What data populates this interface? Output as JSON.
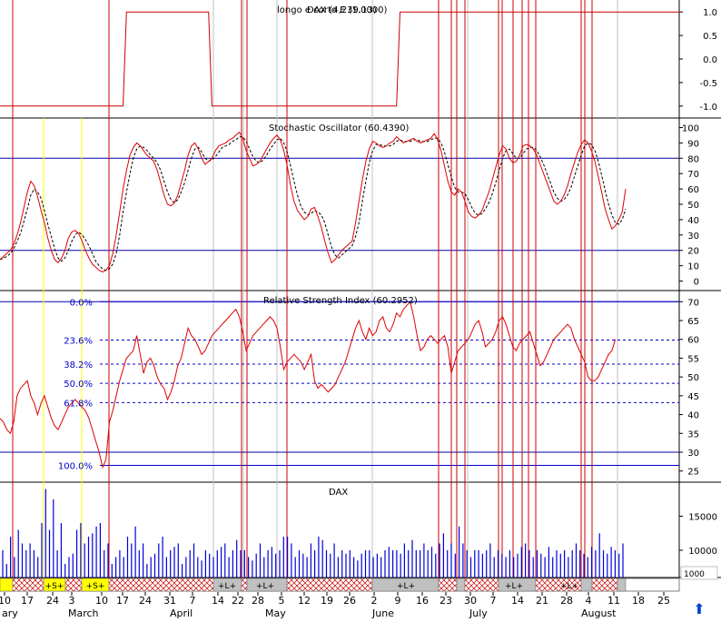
{
  "chart_data": [
    {
      "type": "line",
      "title": "longo e corto E (1.0000)",
      "title_overlay": "DAX (4,239.13)",
      "y_ticks": [
        "1.0",
        "0.5",
        "0.0",
        "-0.5",
        "-1.0"
      ],
      "ylim": [
        -1.1,
        1.1
      ],
      "series": [
        {
          "values": [
            -1,
            -1,
            -1,
            -1,
            -1,
            -1,
            -1,
            -1,
            -1,
            -1,
            -1,
            -1,
            -1,
            -1,
            -1,
            -1,
            -1,
            -1,
            -1,
            -1,
            -1,
            -1,
            -1,
            -1,
            -1,
            -1,
            -1,
            -1,
            -1,
            -1,
            -1,
            -1,
            -1,
            -1,
            -1,
            -1,
            -1,
            1,
            1,
            1,
            1,
            1,
            1,
            1,
            1,
            1,
            1,
            1,
            1,
            1,
            1,
            1,
            1,
            1,
            1,
            1,
            1,
            1,
            1,
            1,
            1,
            1,
            -1,
            -1,
            -1,
            -1,
            -1,
            -1,
            -1,
            -1,
            -1,
            -1,
            -1,
            -1,
            -1,
            -1,
            -1,
            -1,
            -1,
            -1,
            -1,
            -1,
            -1,
            -1,
            -1,
            -1,
            -1,
            -1,
            -1,
            -1,
            -1,
            -1,
            -1,
            -1,
            -1,
            -1,
            -1,
            -1,
            -1,
            -1,
            -1,
            -1,
            -1,
            -1,
            -1,
            -1,
            -1,
            -1,
            -1,
            -1,
            -1,
            -1,
            -1,
            -1,
            -1,
            -1,
            -1,
            1,
            1,
            1,
            1,
            1,
            1,
            1,
            1,
            1,
            1,
            1,
            1,
            1,
            1,
            1,
            1,
            1,
            1,
            1,
            1,
            1,
            1,
            1,
            1,
            1,
            1,
            1,
            1,
            1,
            1,
            1,
            1,
            1,
            1,
            1,
            1,
            1,
            1,
            1,
            1,
            1,
            1,
            1,
            1,
            1,
            1,
            1,
            1,
            1,
            1,
            1,
            1,
            1,
            1,
            1,
            1,
            1,
            1,
            1,
            1,
            1,
            1,
            1,
            1,
            1,
            1,
            1,
            1,
            1,
            1,
            1,
            1,
            1,
            1,
            1,
            1,
            1,
            1,
            1,
            1,
            1,
            1,
            1
          ]
        }
      ]
    },
    {
      "type": "line",
      "title": "Stochastic Oscillator (60.4390)",
      "y_ticks": [
        "100",
        "90",
        "80",
        "70",
        "60",
        "50",
        "40",
        "30",
        "20",
        "10",
        "0"
      ],
      "ylim": [
        -5,
        105
      ],
      "reference_lines": [
        80,
        20
      ],
      "series": [
        {
          "values": [
            14,
            16,
            18,
            20,
            24,
            30,
            38,
            48,
            58,
            65,
            62,
            55,
            46,
            38,
            28,
            20,
            14,
            12,
            15,
            20,
            28,
            32,
            33,
            31,
            26,
            20,
            15,
            11,
            9,
            7,
            6,
            7,
            10,
            18,
            30,
            45,
            60,
            72,
            82,
            87,
            90,
            88,
            85,
            82,
            80,
            78,
            72,
            64,
            56,
            50,
            49,
            51,
            56,
            64,
            72,
            82,
            88,
            90,
            86,
            80,
            76,
            78,
            80,
            85,
            88,
            89,
            90,
            92,
            93,
            95,
            97,
            93,
            85,
            80,
            75,
            76,
            78,
            82,
            86,
            90,
            93,
            95,
            92,
            85,
            75,
            62,
            52,
            46,
            43,
            40,
            42,
            47,
            48,
            42,
            35,
            26,
            18,
            12,
            14,
            17,
            20,
            22,
            24,
            26,
            38,
            52,
            66,
            78,
            86,
            91,
            90,
            88,
            87,
            88,
            90,
            91,
            94,
            92,
            90,
            91,
            92,
            93,
            91,
            90,
            91,
            92,
            93,
            96,
            92,
            85,
            75,
            65,
            58,
            56,
            60,
            58,
            52,
            45,
            42,
            41,
            43,
            46,
            52,
            58,
            66,
            74,
            82,
            88,
            86,
            80,
            77,
            78,
            82,
            88,
            89,
            88,
            86,
            82,
            76,
            70,
            64,
            58,
            52,
            50,
            52,
            56,
            62,
            70,
            77,
            84,
            89,
            92,
            90,
            85,
            78,
            68,
            58,
            47,
            40,
            34,
            36,
            40,
            45,
            60
          ]
        },
        {
          "values": [
            14,
            15,
            16,
            18,
            21,
            26,
            31,
            39,
            47,
            56,
            60,
            58,
            54,
            46,
            37,
            29,
            21,
            15,
            13,
            15,
            20,
            26,
            30,
            32,
            30,
            27,
            23,
            18,
            13,
            10,
            8,
            7,
            8,
            11,
            18,
            30,
            45,
            58,
            70,
            80,
            86,
            88,
            87,
            85,
            82,
            80,
            77,
            72,
            65,
            58,
            53,
            51,
            53,
            58,
            64,
            72,
            80,
            86,
            87,
            84,
            80,
            78,
            79,
            81,
            84,
            87,
            88,
            89,
            91,
            92,
            94,
            94,
            91,
            86,
            81,
            78,
            77,
            79,
            82,
            86,
            89,
            92,
            93,
            90,
            84,
            75,
            65,
            56,
            49,
            45,
            43,
            44,
            46,
            45,
            43,
            38,
            30,
            22,
            17,
            15,
            17,
            19,
            21,
            23,
            29,
            38,
            52,
            65,
            77,
            85,
            89,
            89,
            88,
            88,
            88,
            89,
            91,
            92,
            91,
            91,
            91,
            92,
            92,
            91,
            91,
            91,
            92,
            93,
            93,
            90,
            84,
            76,
            68,
            61,
            58,
            58,
            57,
            53,
            48,
            44,
            43,
            44,
            47,
            51,
            57,
            64,
            72,
            80,
            85,
            86,
            83,
            80,
            80,
            83,
            86,
            87,
            87,
            85,
            81,
            76,
            70,
            64,
            58,
            54,
            52,
            53,
            56,
            61,
            68,
            75,
            82,
            88,
            90,
            89,
            85,
            78,
            69,
            59,
            50,
            43,
            38,
            37,
            40,
            47
          ]
        }
      ]
    },
    {
      "type": "line",
      "title": "Relative Strength Index (60.2952)",
      "y_ticks": [
        "70",
        "65",
        "60",
        "55",
        "50",
        "45",
        "40",
        "35",
        "30",
        "25"
      ],
      "ylim": [
        23,
        72
      ],
      "fib_levels": [
        {
          "label": "0.0%",
          "value": 70
        },
        {
          "label": "23.6%",
          "value": 59.8
        },
        {
          "label": "38.2%",
          "value": 53.4
        },
        {
          "label": "50.0%",
          "value": 48.3
        },
        {
          "label": "61.8%",
          "value": 43.2
        },
        {
          "label": "100.0%",
          "value": 26.5
        }
      ],
      "reference_lines": [
        70,
        30
      ],
      "series": [
        {
          "values": [
            39,
            38,
            36,
            35,
            38,
            45,
            47,
            48,
            49,
            45,
            43,
            40,
            43,
            45,
            42,
            39,
            37,
            36,
            38,
            40,
            42,
            43,
            44,
            43,
            42,
            41,
            39,
            36,
            33,
            30,
            26,
            28,
            38,
            41,
            45,
            49,
            52,
            55,
            56,
            57,
            61,
            56,
            51,
            54,
            55,
            53,
            50,
            48,
            47,
            44,
            46,
            49,
            53,
            55,
            59,
            63,
            61,
            60,
            58,
            56,
            57,
            59,
            61,
            62,
            63,
            64,
            65,
            66,
            67,
            68,
            66,
            62,
            57,
            59,
            61,
            62,
            63,
            64,
            65,
            66,
            65,
            63,
            58,
            52,
            54,
            55,
            56,
            55,
            54,
            52,
            54,
            56,
            49,
            47,
            48,
            47,
            46,
            47,
            48,
            50,
            52,
            54,
            57,
            60,
            63,
            65,
            62,
            60,
            63,
            61,
            62,
            65,
            66,
            63,
            62,
            64,
            67,
            66,
            68,
            69,
            70,
            66,
            61,
            57,
            58,
            60,
            61,
            60,
            59,
            60,
            61,
            58,
            51,
            54,
            57,
            58,
            59,
            60,
            62,
            64,
            65,
            62,
            58,
            59,
            60,
            62,
            65,
            66,
            64,
            61,
            58,
            57,
            59,
            60,
            61,
            62,
            59,
            56,
            53,
            54,
            56,
            58,
            60,
            61,
            62,
            63,
            64,
            63,
            60,
            58,
            56,
            54,
            50,
            49,
            49,
            50,
            52,
            54,
            56,
            57,
            60
          ]
        }
      ]
    },
    {
      "type": "bar",
      "title": "DAX",
      "y_ticks": [
        "15000",
        "10000"
      ],
      "ylim": [
        6000,
        20000
      ],
      "series": [
        {
          "values": [
            10000,
            8000,
            12000,
            9000,
            13000,
            11000,
            10000,
            11000,
            10000,
            9000,
            14000,
            19000,
            13000,
            17500,
            10000,
            14000,
            8000,
            9000,
            9500,
            13000,
            14000,
            11000,
            12000,
            12500,
            13500,
            14000,
            10000,
            11000,
            8000,
            9000,
            10000,
            9000,
            12000,
            11000,
            13500,
            10000,
            11000,
            8000,
            9000,
            9500,
            11000,
            12000,
            9000,
            10000,
            10500,
            11000,
            8000,
            9000,
            10000,
            11000,
            9000,
            8500,
            10000,
            9500,
            9000,
            10000,
            10500,
            11000,
            9000,
            10000,
            11500,
            10000,
            10000,
            9000,
            8500,
            9500,
            11000,
            9000,
            10000,
            10500,
            9500,
            10000,
            12000,
            12000,
            11000,
            9000,
            10000,
            9500,
            9000,
            11000,
            10000,
            12000,
            11500,
            10000,
            9500,
            11000,
            9000,
            10000,
            9500,
            10000,
            9000,
            8500,
            9500,
            10000,
            10000,
            9000,
            9500,
            9000,
            10000,
            10500,
            10000,
            10000,
            9500,
            11000,
            10000,
            11500,
            10000,
            10000,
            11000,
            10000,
            10500,
            9500,
            11000,
            12500,
            10000,
            11000,
            9500,
            13500,
            11000,
            10000,
            9000,
            10000,
            10000,
            9500,
            10000,
            11000,
            9000,
            10000,
            9500,
            9000,
            10000,
            9000,
            9500,
            10500,
            11000,
            10000,
            9000,
            10000,
            9500,
            9000,
            10500,
            9000,
            10000,
            9500,
            10000,
            9000,
            10000,
            11000,
            10000,
            9500,
            9000,
            10500,
            10000,
            12500,
            10000,
            9500,
            10500,
            10000,
            9500,
            11000
          ]
        }
      ]
    }
  ],
  "strip_labels": [
    "+S+",
    "+S+",
    "+L+",
    "+L+",
    "+L+",
    "+L+",
    "+L+"
  ],
  "date_labels": [
    "10",
    "17",
    "24",
    "3",
    "10",
    "17",
    "24",
    "31",
    "7",
    "14",
    "22",
    "28",
    "5",
    "12",
    "19",
    "26",
    "2",
    "9",
    "16",
    "23",
    "30",
    "7",
    "14",
    "21",
    "28",
    "4",
    "11",
    "18",
    "25"
  ],
  "month_labels": [
    "ary",
    "March",
    "April",
    "May",
    "June",
    "July",
    "August"
  ],
  "scroll_value": "1000",
  "scroll_arrow": "⬆"
}
